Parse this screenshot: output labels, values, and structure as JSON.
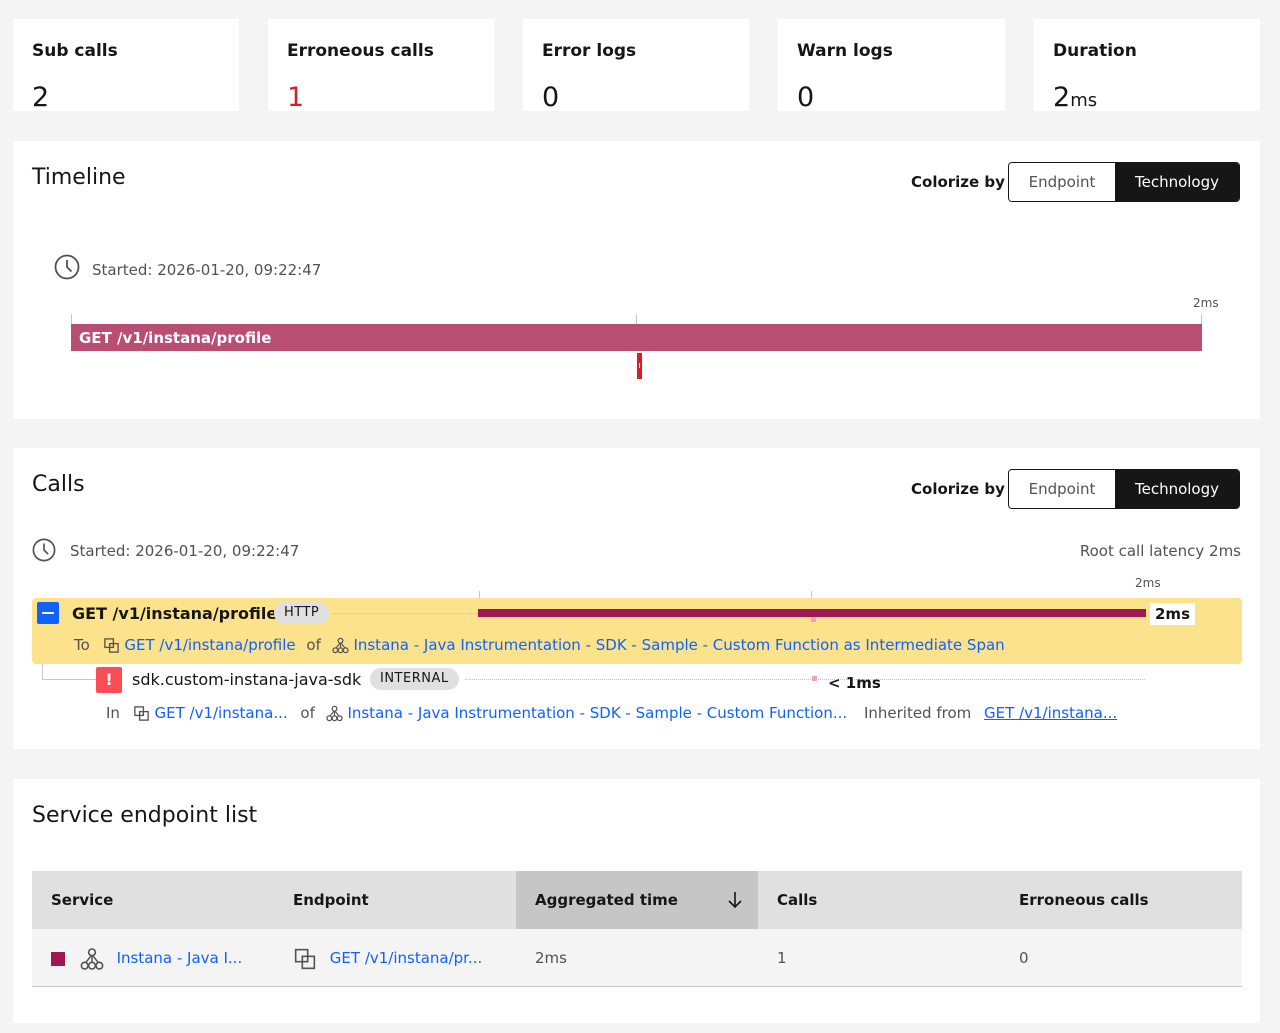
{
  "stats": [
    {
      "title": "Sub calls",
      "value": "2",
      "unit": ""
    },
    {
      "title": "Erroneous calls",
      "value": "1",
      "unit": ""
    },
    {
      "title": "Error logs",
      "value": "0",
      "unit": ""
    },
    {
      "title": "Warn logs",
      "value": "0",
      "unit": ""
    },
    {
      "title": "Duration",
      "value": "2",
      "unit": "ms"
    }
  ],
  "timeline": {
    "title": "Timeline",
    "colorize_label": "Colorize by",
    "colorize_options": [
      "Endpoint",
      "Technology"
    ],
    "colorize_selected": "Technology",
    "started": "Started: 2026-01-20, 09:22:47",
    "scale_end": "2ms",
    "bar_label": "GET /v1/instana/profile",
    "bar_color": "#b84f72",
    "error_marker_color": "#da1e28"
  },
  "calls": {
    "title": "Calls",
    "colorize_label": "Colorize by",
    "colorize_options": [
      "Endpoint",
      "Technology"
    ],
    "colorize_selected": "Technology",
    "started": "Started: 2026-01-20, 09:22:47",
    "root_latency": "Root call latency 2ms",
    "scale_end": "2ms",
    "rows": [
      {
        "name": "GET /v1/instana/profile",
        "tag": "HTTP",
        "duration": "2ms",
        "detail_prefix": "To",
        "endpoint": "GET /v1/instana/profile",
        "of": "of",
        "service": "Instana - Java Instrumentation - SDK - Sample - Custom Function as Intermediate Span",
        "highlight_color": "#fde28c",
        "bar_color": "#9e1853"
      },
      {
        "name": "sdk.custom-instana-java-sdk",
        "tag": "INTERNAL",
        "duration": "< 1ms",
        "detail_prefix": "In",
        "endpoint": "GET /v1/instana...",
        "of": "of",
        "service": "Instana - Java Instrumentation - SDK - Sample - Custom Function...",
        "inherited_label": "Inherited from",
        "inherited_link": "GET /v1/instana...",
        "error_icon": "!"
      }
    ]
  },
  "endpoint_list": {
    "title": "Service endpoint list",
    "columns": [
      "Service",
      "Endpoint",
      "Aggregated time",
      "Calls",
      "Erroneous calls"
    ],
    "sort_column": "Aggregated time",
    "rows": [
      {
        "service": "Instana - Java I...",
        "endpoint": "GET /v1/instana/pr...",
        "aggregated_time": "2ms",
        "calls": "1",
        "erroneous_calls": "0",
        "service_color": "#9e1853"
      }
    ]
  }
}
